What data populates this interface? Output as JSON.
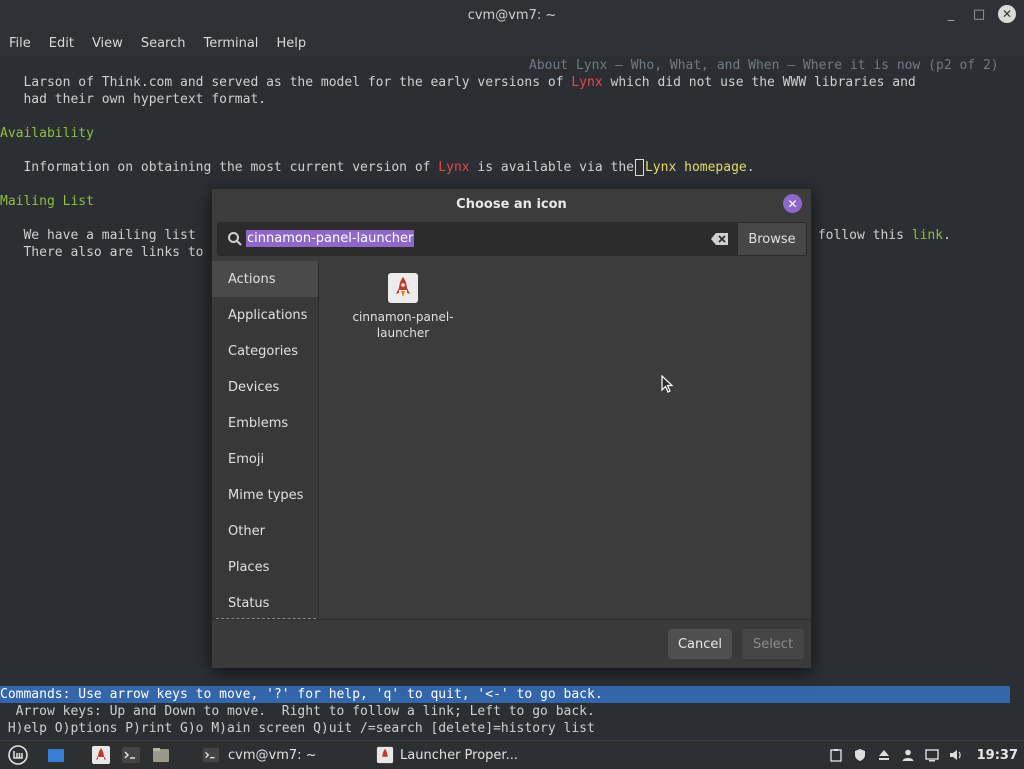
{
  "window": {
    "title": "cvm@vm7: ~",
    "minimize": "_",
    "maximize": "□",
    "close": "✕"
  },
  "menu": [
    "File",
    "Edit",
    "View",
    "Search",
    "Terminal",
    "Help"
  ],
  "terminal": {
    "page_header": "About Lynx — Who, What, and When — Where it is now (p2 of 2)",
    "line1_a": "   Larson of Think.com and served as the model for the early versions of ",
    "line1_link": "Lynx",
    "line1_b": " which did not use the WWW libraries and",
    "line2": "   had their own hypertext format.",
    "heading_availability": "Availability",
    "avail_a": "   Information on obtaining the most current version of ",
    "avail_lynx": "Lynx",
    "avail_b": " is available via the",
    "avail_link": "Lynx homepage",
    "avail_end": ".",
    "heading_mailing": "Mailing List",
    "mail_a": "   We have a mailing list",
    "mail_b": " follow this ",
    "mail_link": "link",
    "mail_end": ".",
    "mail2": "   There also are links to",
    "commands": "Commands: Use arrow keys to move, '?' for help, 'q' to quit, '<-' to go back.",
    "help1": "  Arrow keys: Up and Down to move.  Right to follow a link; Left to go back.",
    "help2": " H)elp O)ptions P)rint G)o M)ain screen Q)uit /=search [delete]=history list"
  },
  "dialog": {
    "title": "Choose an icon",
    "search_value": "cinnamon-panel-launcher",
    "browse": "Browse",
    "categories": [
      "Actions",
      "Applications",
      "Categories",
      "Devices",
      "Emblems",
      "Emoji",
      "Mime types",
      "Other",
      "Places",
      "Status"
    ],
    "result_label_1": "cinnamon-panel-",
    "result_label_2": "launcher",
    "cancel": "Cancel",
    "select": "Select"
  },
  "taskbar": {
    "terminal_window": "cvm@vm7: ~",
    "launcher_window": "Launcher Proper...",
    "clock": "19:37"
  },
  "colors": {
    "accent": "#8e67c8",
    "command_bar": "#3366aa",
    "link_red": "#e8464b",
    "heading_green": "#8fbe3e"
  }
}
